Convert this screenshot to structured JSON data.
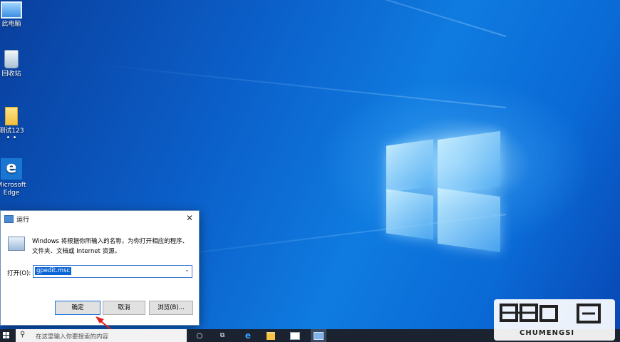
{
  "desktop": {
    "icons": [
      {
        "label": "此电脑",
        "icon": "this-pc-icon"
      },
      {
        "label": "回收站",
        "icon": "recycle-bin-icon"
      },
      {
        "label": "测试123",
        "icon": "folder-icon"
      },
      {
        "label": "Microsoft Edge",
        "icon": "edge-icon"
      }
    ],
    "colors": {
      "wallpaper": "#0b5fc9",
      "logo_glow": "#aee2ff"
    }
  },
  "run_dialog": {
    "title": "运行",
    "description": "Windows 将根据你所输入的名称，为你打开相应的程序、文件夹、文档或 Internet 资源。",
    "open_label": "打开(O):",
    "input_value": "gpedit.msc",
    "ok_label": "确定",
    "cancel_label": "取消",
    "browse_label": "浏览(B)..."
  },
  "taskbar": {
    "search_placeholder": "在这里输入你要搜索的内容",
    "icons": [
      "start-icon",
      "search-icon",
      "cortana-icon",
      "task-view-icon",
      "edge-icon",
      "file-explorer-icon",
      "mail-icon",
      "run-icon"
    ]
  },
  "watermark": {
    "text": "CHUMENGSI"
  }
}
